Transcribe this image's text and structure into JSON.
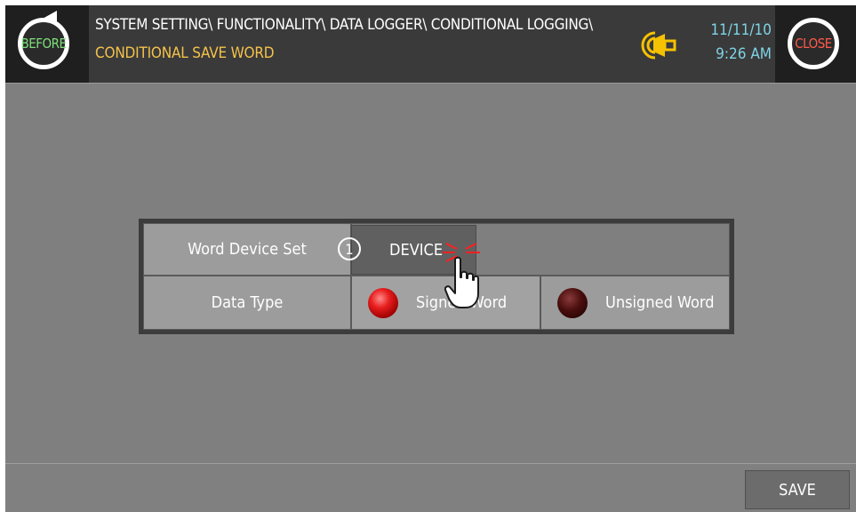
{
  "header": {
    "before_label": "BEFORE",
    "close_label": "CLOSE",
    "path": "SYSTEM SETTING\\ FUNCTIONALITY\\ DATA LOGGER\\ CONDITIONAL LOGGING\\",
    "subpath": "CONDITIONAL SAVE WORD",
    "date": "11/11/10",
    "time": "9:26 AM",
    "colors": {
      "path": "#ffffff",
      "subpath": "#f5c24a",
      "clock": "#7fd4e6",
      "before": "#7fe07a",
      "close": "#ff5a4a"
    },
    "icons": {
      "before": "rotate-arrow-icon",
      "alarm": "alarm-bell-icon"
    }
  },
  "form": {
    "word_device_label": "Word Device Set",
    "step_marker": "1",
    "device_button": "DEVICE",
    "data_type_label": "Data Type",
    "options": [
      {
        "label": "Signed Word",
        "selected": true
      },
      {
        "label": "Unsigned Word",
        "selected": false
      }
    ]
  },
  "footer": {
    "save_label": "SAVE"
  }
}
